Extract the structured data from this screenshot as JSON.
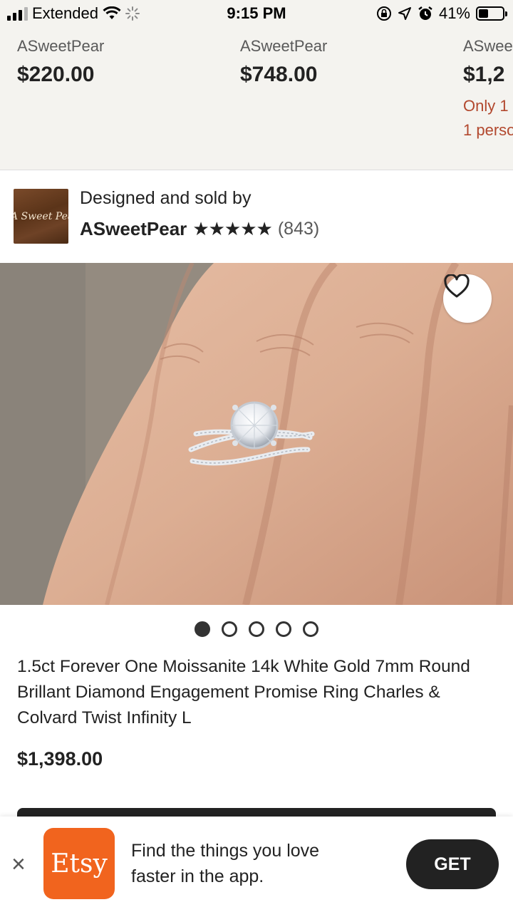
{
  "status_bar": {
    "carrier": "Extended",
    "time": "9:15 PM",
    "battery": "41%",
    "battery_level": 0.41,
    "icons": [
      "signal-icon",
      "wifi-icon",
      "loading-icon",
      "orientation-lock-icon",
      "location-icon",
      "alarm-icon",
      "battery-icon"
    ]
  },
  "related": [
    {
      "shop": "ASweetPear",
      "price": "$220.00"
    },
    {
      "shop": "ASweetPear",
      "price": "$748.00"
    },
    {
      "shop": "ASwee",
      "price": "$1,2",
      "note1": "Only 1",
      "note2": "1 perso"
    }
  ],
  "seller": {
    "logo_text": "A Sweet Pear",
    "sold_by": "Designed and sold by",
    "name": "ASweetPear",
    "stars": "★★★★★",
    "rating": 5,
    "reviews": "(843)"
  },
  "gallery": {
    "image_count": 5,
    "active_index": 0
  },
  "listing": {
    "title": "1.5ct Forever One Moissanite 14k White Gold 7mm Round Brillant Diamond Engagement Promise Ring Charles & Colvard Twist Infinity L",
    "price": "$1,398.00"
  },
  "app_banner": {
    "close": "×",
    "logo": "Etsy",
    "text_line1": "Find the things you love",
    "text_line2": "faster in the app.",
    "button": "GET"
  },
  "colors": {
    "accent": "#f1641e",
    "warning_text": "#b2482e",
    "background_strip": "#f4f3ef"
  }
}
